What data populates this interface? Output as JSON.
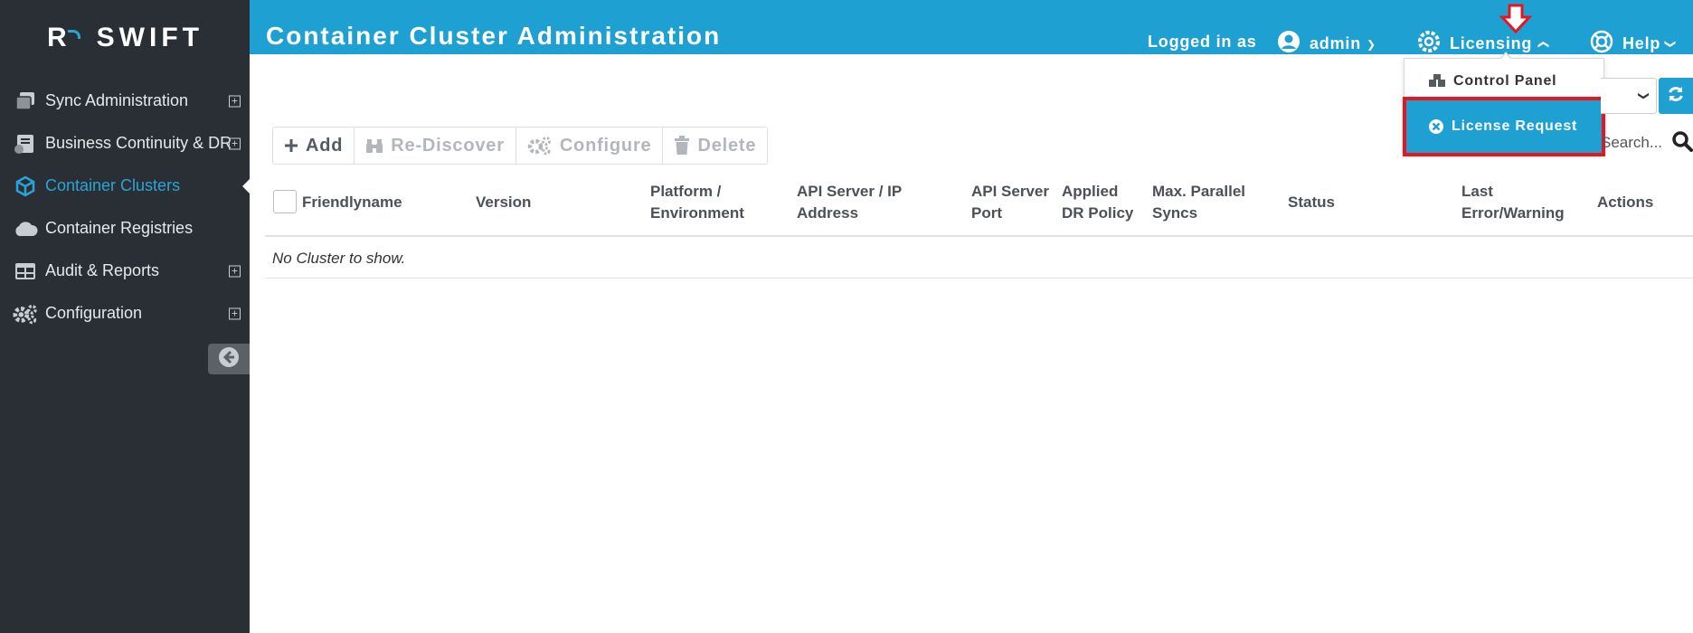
{
  "brand": {
    "name": "SWIFT",
    "prefix": "R"
  },
  "sidebar": {
    "items": [
      {
        "label": "Sync Administration",
        "expandable": true
      },
      {
        "label": "Business Continuity & DR",
        "expandable": true
      },
      {
        "label": "Container Clusters",
        "expandable": false,
        "active": true
      },
      {
        "label": "Container Registries",
        "expandable": false
      },
      {
        "label": "Audit & Reports",
        "expandable": true
      },
      {
        "label": "Configuration",
        "expandable": true
      }
    ],
    "expand_symbol": "+"
  },
  "header": {
    "title": "Container Cluster Administration",
    "logged_in_label": "Logged in as",
    "user": "admin",
    "licensing": "Licensing",
    "help": "Help"
  },
  "licensing_menu": {
    "items": [
      {
        "label": "Control Panel"
      },
      {
        "label": "License Request",
        "highlighted": true
      }
    ]
  },
  "toolbar": {
    "add": "Add",
    "rediscover": "Re-Discover",
    "configure": "Configure",
    "delete": "Delete"
  },
  "search": {
    "placeholder": "Search..."
  },
  "table": {
    "columns": [
      {
        "line1": "Friendlyname",
        "line2": ""
      },
      {
        "line1": "Version",
        "line2": ""
      },
      {
        "line1": "Platform /",
        "line2": "Environment"
      },
      {
        "line1": "API Server / IP",
        "line2": "Address"
      },
      {
        "line1": "API Server",
        "line2": "Port"
      },
      {
        "line1": "Applied",
        "line2": "DR Policy"
      },
      {
        "line1": "Max. Parallel",
        "line2": "Syncs"
      },
      {
        "line1": "Status",
        "line2": ""
      },
      {
        "line1": "Last",
        "line2": "Error/Warning"
      },
      {
        "line1": "Actions",
        "line2": ""
      }
    ],
    "empty_message": "No Cluster to show."
  },
  "colors": {
    "header_bg": "#1ea0d2",
    "sidebar_bg": "#2a2f36",
    "active_nav": "#2aa4d8",
    "highlight_outline": "#e8141e"
  }
}
